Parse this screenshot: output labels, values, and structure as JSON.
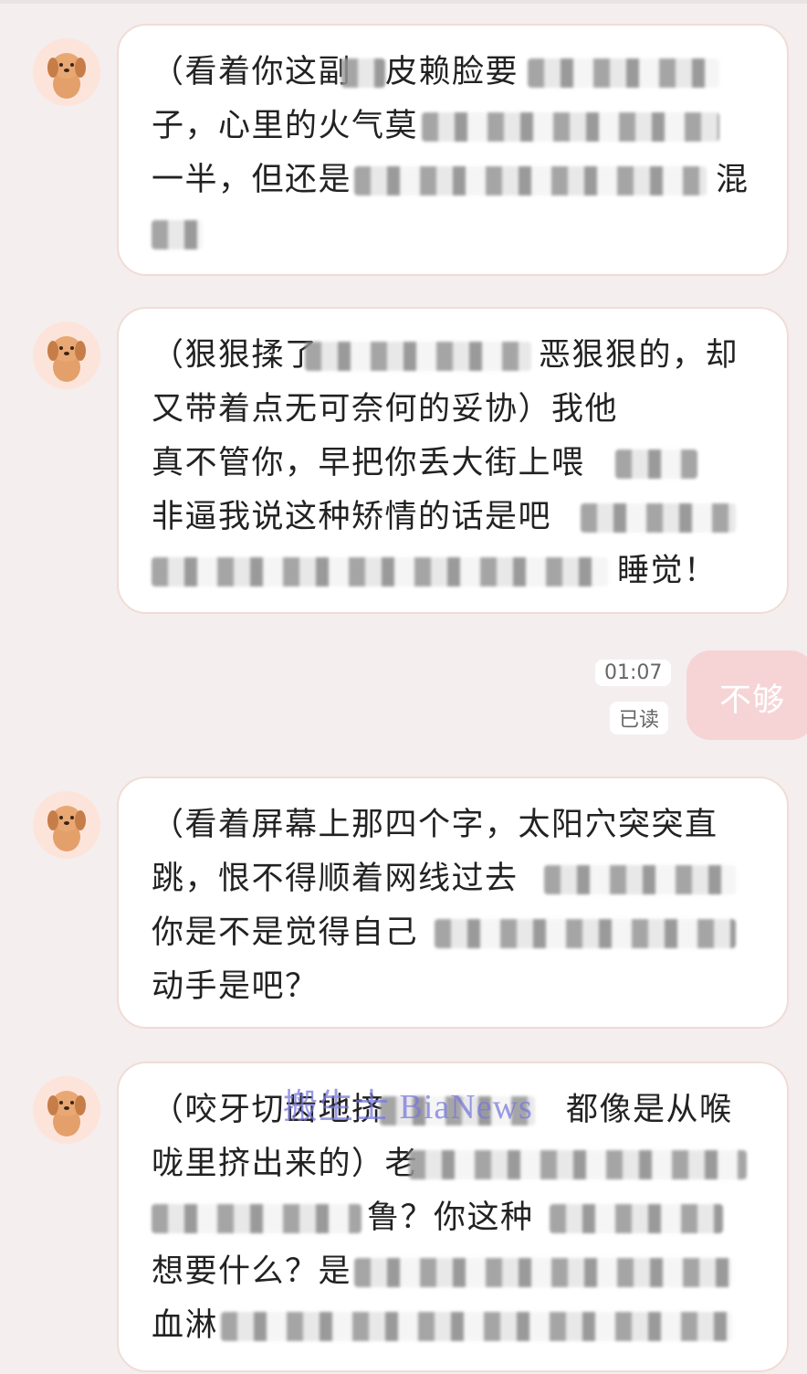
{
  "messages": [
    {
      "lines": [
        "（看着你这副",
        "子，心里的火气莫",
        "一半，但还是",
        ""
      ],
      "last": "混"
    },
    {
      "lines": [
        "（狠狠揉了",
        "又带着点无可奈何的妥协）我他",
        "真不管你，早把你丢大街上喂",
        "非逼我说这种矫情的话是吧",
        ""
      ],
      "tail1": "恶狠狠的，却",
      "last": "睡觉！"
    },
    {
      "lines": [
        "（看着屏幕上那四个字，太阳穴突突直",
        "跳，恨不得顺着网线过去",
        "你是不是觉得自己",
        "动手是吧？"
      ]
    },
    {
      "lines": [
        "（咬牙切齿地挤",
        "咙里挤出来的）老",
        "",
        "想要什么？是",
        "血淋"
      ],
      "tail1": "都像是从喉",
      "mid": "鲁？你这种"
    }
  ],
  "sent": {
    "text": "不够",
    "time": "01:07",
    "status": "已读"
  },
  "watermark": "搬生士 BiaNews",
  "colors": {
    "background": "#f4eeee",
    "bubble": "#ffffff",
    "avatar_bg": "#fde4da",
    "sent_bubble": "#f6d4d6"
  }
}
